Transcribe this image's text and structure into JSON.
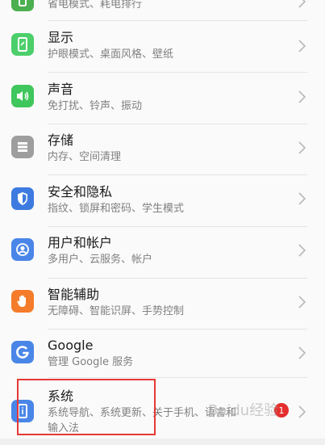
{
  "rows": [
    {
      "key": "battery",
      "title": "",
      "subtitle": "省电模式、耗电排行",
      "icon": "battery-icon",
      "color": "#4caf50"
    },
    {
      "key": "display",
      "title": "显示",
      "subtitle": "护眼模式、桌面风格、壁纸",
      "icon": "display-icon",
      "color": "#4ccf6a"
    },
    {
      "key": "sound",
      "title": "声音",
      "subtitle": "免打扰、铃声、振动",
      "icon": "speaker-icon",
      "color": "#3fc65c"
    },
    {
      "key": "storage",
      "title": "存储",
      "subtitle": "内存、空间清理",
      "icon": "storage-icon",
      "color": "#9e9e9e"
    },
    {
      "key": "security",
      "title": "安全和隐私",
      "subtitle": "指纹、锁屏和密码、学生模式",
      "icon": "shield-icon",
      "color": "#3d7be0"
    },
    {
      "key": "accounts",
      "title": "用户和帐户",
      "subtitle": "多用户、云服务、帐户",
      "icon": "user-icon",
      "color": "#4a86e8"
    },
    {
      "key": "accessibility",
      "title": "智能辅助",
      "subtitle": "无障碍、智能识屏、手势控制",
      "icon": "hand-icon",
      "color": "#f57c2a"
    },
    {
      "key": "google",
      "title": "Google",
      "subtitle": "管理 Google 服务",
      "icon": "google-icon",
      "color": "#4a86e8"
    },
    {
      "key": "system",
      "title": "系统",
      "subtitle": "系统导航、系统更新、关于手机、语言和",
      "subtitle2": "输入法",
      "icon": "phone-info-icon",
      "color": "#4a86e8"
    }
  ],
  "badge": {
    "count": "1"
  },
  "watermark": {
    "text": "Baidu经验"
  }
}
